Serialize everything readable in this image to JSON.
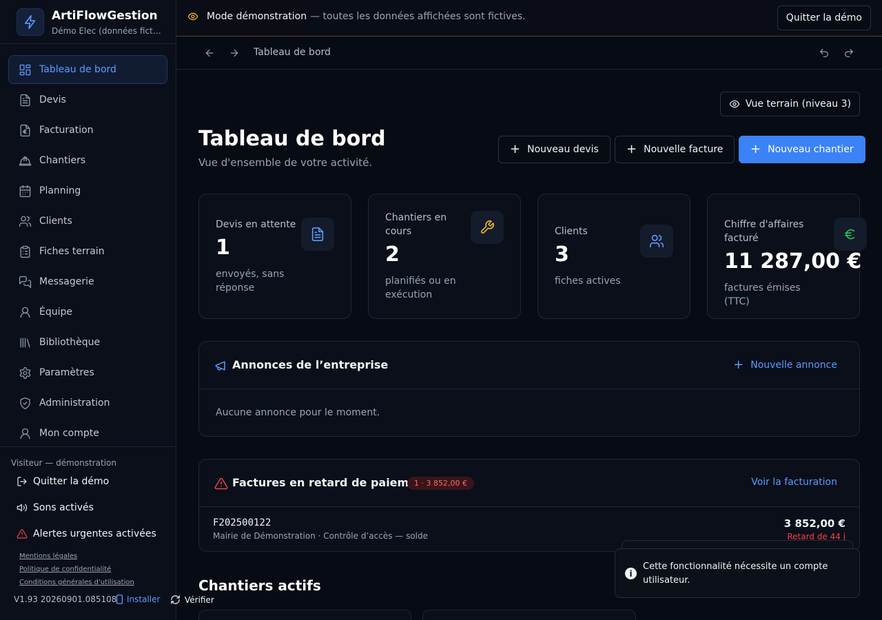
{
  "brand": {
    "name": "ArtiFlowGestion",
    "subtitle": "Démo Élec (données fictiv..."
  },
  "sidebar": {
    "items": [
      {
        "label": "Tableau de bord",
        "icon": "dashboard-icon",
        "active": true
      },
      {
        "label": "Devis",
        "icon": "file-text-icon"
      },
      {
        "label": "Facturation",
        "icon": "euro-file-icon"
      },
      {
        "label": "Chantiers",
        "icon": "hard-hat-icon"
      },
      {
        "label": "Planning",
        "icon": "calendar-icon"
      },
      {
        "label": "Clients",
        "icon": "users-icon"
      },
      {
        "label": "Fiches terrain",
        "icon": "clipboard-icon"
      },
      {
        "label": "Messagerie",
        "icon": "messages-icon"
      },
      {
        "label": "Équipe",
        "icon": "user-icon"
      },
      {
        "label": "Bibliothèque",
        "icon": "library-icon"
      },
      {
        "label": "Paramètres",
        "icon": "gear-icon"
      },
      {
        "label": "Administration",
        "icon": "shield-icon"
      },
      {
        "label": "Mon compte",
        "icon": "user-icon"
      }
    ],
    "footer": {
      "visitor": "Visiteur — démonstration",
      "quit": "Quitter la démo",
      "sounds": "Sons activés",
      "alerts": "Alertes urgentes activées",
      "legal": [
        "Mentions légales",
        "Politique de confidentialité",
        "Conditions générales d'utilisation"
      ],
      "version": "V1.93 20260901.085108",
      "install": "Installer",
      "verify": "Vérifier"
    }
  },
  "banner": {
    "title": "Mode démonstration",
    "text": "— toutes les données affichées sont fictives.",
    "quit_button": "Quitter la démo"
  },
  "breadcrumb": {
    "current": "Tableau de bord"
  },
  "header": {
    "field_view_button": "Vue terrain (niveau 3)",
    "title": "Tableau de bord",
    "subtitle": "Vue d'ensemble de votre activité.",
    "actions": [
      "Nouveau devis",
      "Nouvelle facture",
      "Nouveau chantier"
    ]
  },
  "stats": [
    {
      "label": "Devis en attente",
      "value": "1",
      "desc": "envoyés, sans réponse",
      "icon_color": "#5b9bff"
    },
    {
      "label": "Chantiers en cours",
      "value": "2",
      "desc": "planifiés ou en exécution",
      "icon_color": "#f0b429"
    },
    {
      "label": "Clients",
      "value": "3",
      "desc": "fiches actives",
      "icon_color": "#5b9bff"
    },
    {
      "label": "Chiffre d'affaires facturé",
      "value": "11 287,00 €",
      "desc": "factures émises (TTC)",
      "icon_color": "#22c55e"
    }
  ],
  "announcements": {
    "title": "Annonces de l’entreprise",
    "new_button": "Nouvelle annonce",
    "empty": "Aucune annonce pour le moment."
  },
  "overdue": {
    "title": "Factures en retard de paiement",
    "badge": "1 · 3 852,00 €",
    "link": "Voir la facturation",
    "rows": [
      {
        "number": "F202500122",
        "detail": "Mairie de Démonstration · Contrôle d’accès — solde",
        "amount": "3 852,00 €",
        "late": "Retard de 44 j"
      }
    ]
  },
  "active_sites": {
    "title": "Chantiers actifs"
  },
  "toast": {
    "message": "Cette fonctionnalité nécessite un compte utilisateur."
  },
  "colors": {
    "accent": "#3b82f6",
    "danger": "#ef4444",
    "warning": "#f0b429",
    "success": "#22c55e"
  }
}
